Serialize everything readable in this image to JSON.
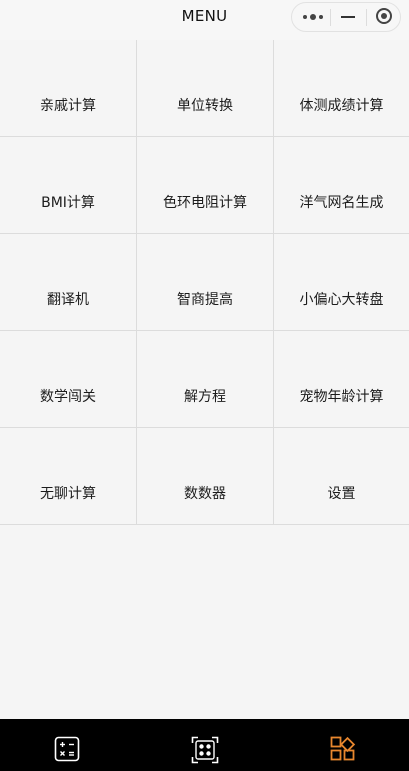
{
  "header": {
    "title": "MENU",
    "capsule": {
      "more_icon": "more-dots-icon",
      "minimize_icon": "minimize-icon",
      "close_icon": "target-circle-icon"
    }
  },
  "menu_items": [
    {
      "label": "亲戚计算"
    },
    {
      "label": "单位转换"
    },
    {
      "label": "体测成绩计算"
    },
    {
      "label": "BMI计算"
    },
    {
      "label": "色环电阻计算"
    },
    {
      "label": "洋气网名生成"
    },
    {
      "label": "翻译机"
    },
    {
      "label": "智商提高"
    },
    {
      "label": "小偏心大转盘"
    },
    {
      "label": "数学闯关"
    },
    {
      "label": "解方程"
    },
    {
      "label": "宠物年龄计算"
    },
    {
      "label": "无聊计算"
    },
    {
      "label": "数数器"
    },
    {
      "label": "设置"
    }
  ],
  "tabbar": {
    "tabs": [
      {
        "icon": "calculator-icon",
        "active": false
      },
      {
        "icon": "scan-dots-icon",
        "active": false
      },
      {
        "icon": "apps-grid-icon",
        "active": true
      }
    ],
    "colors": {
      "background": "#000000",
      "icon": "#ffffff",
      "active": "#e8872e"
    }
  }
}
